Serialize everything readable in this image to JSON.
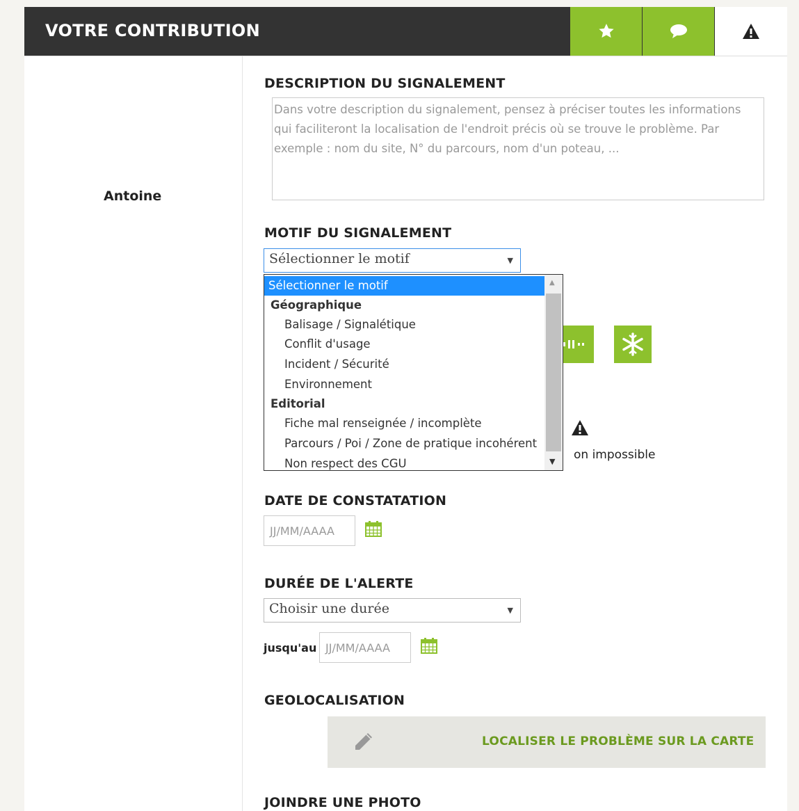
{
  "header": {
    "title": "VOTRE CONTRIBUTION",
    "tabs": [
      "star-icon",
      "comment-icon",
      "alert-icon"
    ]
  },
  "user": {
    "name": "Antoine"
  },
  "description": {
    "label": "DESCRIPTION DU SIGNALEMENT",
    "placeholder": "Dans votre description du signalement, pensez à préciser toutes les informations qui faciliteront la localisation de l'endroit précis où se trouve le problème. Par exemple : nom du site, N° du parcours, nom d'un poteau, ..."
  },
  "motif": {
    "label": "MOTIF DU SIGNALEMENT",
    "selected": "Sélectionner le motif",
    "options": [
      {
        "label": "Sélectionner le motif",
        "kind": "selected"
      },
      {
        "label": "Géographique",
        "kind": "group"
      },
      {
        "label": "Balisage / Signalétique",
        "kind": "item"
      },
      {
        "label": "Conflit d'usage",
        "kind": "item"
      },
      {
        "label": "Incident / Sécurité",
        "kind": "item"
      },
      {
        "label": "Environnement",
        "kind": "item"
      },
      {
        "label": "Editorial",
        "kind": "group"
      },
      {
        "label": "Fiche mal renseignée / incomplète",
        "kind": "item"
      },
      {
        "label": "Parcours / Poi / Zone de pratique incohérent",
        "kind": "item"
      },
      {
        "label": "Non respect des CGU",
        "kind": "item"
      }
    ]
  },
  "hidden_text": "on impossible",
  "date": {
    "label": "DATE DE CONSTATATION",
    "placeholder": "JJ/MM/AAAA"
  },
  "duree": {
    "label": "DURÉE DE L'ALERTE",
    "selected": "Choisir une durée",
    "until_label": "jusqu'au",
    "until_placeholder": "JJ/MM/AAAA"
  },
  "geo": {
    "label": "GEOLOCALISATION",
    "button": "LOCALISER LE PROBLÈME SUR LA CARTE"
  },
  "photo": {
    "label": "JOINDRE UNE PHOTO"
  },
  "colors": {
    "accent": "#8dc12d",
    "header_bg": "#333333",
    "link_green": "#6b9a1f",
    "selection": "#1e90ff"
  }
}
